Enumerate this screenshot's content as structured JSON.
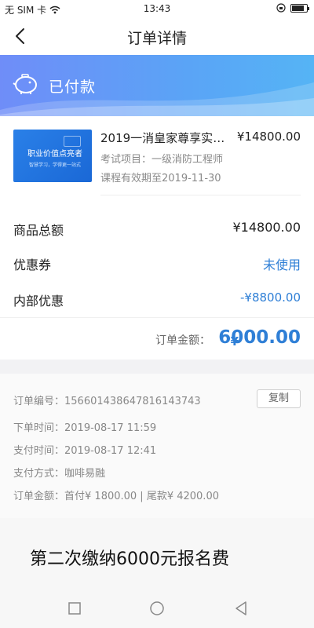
{
  "status_bar": {
    "carrier": "无 SIM 卡",
    "time": "13:43",
    "battery_level": 0.85
  },
  "nav": {
    "title": "订单详情",
    "back_icon": "chevron-left-icon"
  },
  "banner": {
    "status": "已付款",
    "icon": "piggy-bank-icon",
    "gradient": [
      "#6f8df8",
      "#55b4f5"
    ]
  },
  "course": {
    "thumbnail_title": "职业价值点亮者",
    "thumbnail_subtitle": "智慧学习，学得更一站式",
    "title": "2019一消皇家尊享实战...",
    "price": "¥14800.00",
    "subject": "考试项目：一级消防工程师",
    "valid_until": "课程有效期至2019-11-30"
  },
  "summary": {
    "items": [
      {
        "label": "商品总额",
        "value": "¥14800.00"
      },
      {
        "label": "优惠券",
        "value": "未使用"
      },
      {
        "label": "内部优惠",
        "value": "-¥8800.00"
      }
    ],
    "total_label": "订单金额：",
    "total_currency": "¥",
    "total_amount": "6000.00",
    "accent": "#2f7fd6"
  },
  "order_info": {
    "number_label": "订单编号：",
    "number_value": "156601438647816143743",
    "copy_label": "复制",
    "rows": [
      {
        "label": "下单时间：",
        "value": "2019-08-17 11:59"
      },
      {
        "label": "支付时间：",
        "value": "2019-08-17 12:41"
      },
      {
        "label": "支付方式：",
        "value": "咖啡易融"
      },
      {
        "label": "订单金额：",
        "value": "首付¥ 1800.00 | 尾款¥ 4200.00"
      }
    ]
  },
  "caption": "第二次缴纳6000元报名费",
  "system_nav": [
    "square-icon",
    "circle-icon",
    "triangle-back-icon"
  ]
}
